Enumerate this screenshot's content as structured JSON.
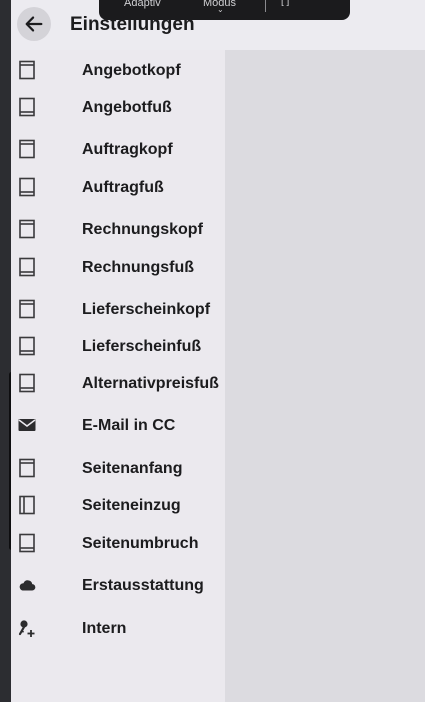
{
  "overlay": {
    "label_left": "Adaptiv",
    "label_mode": "Modus",
    "bracket": "[ ]"
  },
  "header": {
    "title": "Einstellungen",
    "back_icon": "arrow-left-icon"
  },
  "sidebar": {
    "items": [
      {
        "label": "Angebotkopf",
        "icon": "page-header-icon"
      },
      {
        "label": "Angebotfuß",
        "icon": "page-footer-icon"
      },
      {
        "label": "Auftragkopf",
        "icon": "page-header-icon"
      },
      {
        "label": "Auftragfuß",
        "icon": "page-footer-icon"
      },
      {
        "label": "Rechnungskopf",
        "icon": "page-header-icon"
      },
      {
        "label": "Rechnungsfuß",
        "icon": "page-footer-icon"
      },
      {
        "label": "Lieferscheinkopf",
        "icon": "page-header-icon"
      },
      {
        "label": "Lieferscheinfuß",
        "icon": "page-footer-icon"
      },
      {
        "label": "Alternativpreisfuß",
        "icon": "page-footer-icon"
      },
      {
        "label": "E-Mail in CC",
        "icon": "mail-icon"
      },
      {
        "label": "Seitenanfang",
        "icon": "page-header-icon"
      },
      {
        "label": "Seiteneinzug",
        "icon": "page-indent-icon"
      },
      {
        "label": "Seitenumbruch",
        "icon": "page-footer-icon"
      },
      {
        "label": "Erstausstattung",
        "icon": "cloud-icon"
      },
      {
        "label": "Intern",
        "icon": "key-plus-icon"
      }
    ]
  },
  "colors": {
    "sidebar_bg": "#ebe9ee",
    "content_bg": "#dcdbe0",
    "text": "#1c1c1e"
  }
}
